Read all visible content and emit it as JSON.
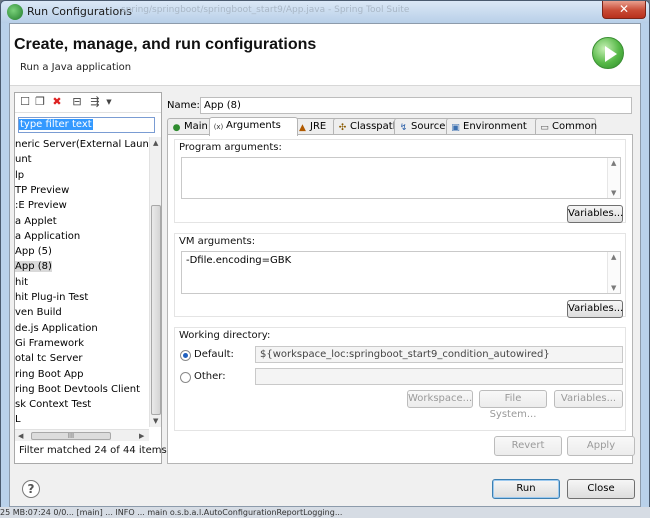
{
  "window": {
    "title": "Run Configurations",
    "faded_title": "spring/springboot/springboot_start9/App.java - Spring Tool Suite",
    "close_glyph": "✕"
  },
  "header": {
    "title": "Create, manage, and run configurations",
    "subtitle": "Run a Java application"
  },
  "left_panel": {
    "toolbar_icons": [
      "new-config-icon",
      "duplicate-icon",
      "delete-icon",
      "collapse-all-icon",
      "filter-icon",
      "dropdown-icon"
    ],
    "filter_placeholder": "type filter text",
    "items": [
      "neric Server(External Launch",
      "unt",
      "lp",
      "TP Preview",
      ":E Preview",
      "a Applet",
      "a Application",
      "App (5)",
      "App (8)",
      "hit",
      "hit Plug-in Test",
      "ven Build",
      "de.js Application",
      "Gi Framework",
      "otal tc Server",
      "ring Boot App",
      "ring Boot Devtools Client",
      "sk Context Test",
      "L"
    ],
    "selected_index": 8,
    "scroll_thumb_label": "III",
    "status": "Filter matched 24 of 44 items"
  },
  "config": {
    "name_label": "Name:",
    "name_value": "App (8)",
    "tabs": [
      {
        "label": "Main",
        "icon": "main-icon"
      },
      {
        "label": "Arguments",
        "icon": "arguments-icon"
      },
      {
        "label": "JRE",
        "icon": "jre-icon"
      },
      {
        "label": "Classpath",
        "icon": "classpath-icon"
      },
      {
        "label": "Source",
        "icon": "source-icon"
      },
      {
        "label": "Environment",
        "icon": "environment-icon"
      },
      {
        "label": "Common",
        "icon": "common-icon"
      }
    ],
    "active_tab": "Arguments",
    "program_args_label": "Program arguments:",
    "program_args_value": "",
    "vm_args_label": "VM arguments:",
    "vm_args_value": "-Dfile.encoding=GBK",
    "variables_button": "Variables...",
    "working_dir_label": "Working directory:",
    "default_label": "Default:",
    "default_value": "${workspace_loc:springboot_start9_condition_autowired}",
    "other_label": "Other:",
    "other_value": "",
    "workspace_button": "Workspace...",
    "filesystem_button": "File System...",
    "variables_button_2": "Variables...",
    "revert_button": "Revert",
    "apply_button": "Apply"
  },
  "footer": {
    "help_glyph": "?",
    "run_button": "Run",
    "close_button": "Close"
  },
  "bottom_strip_text": "25 MB:07:24 0/0...  [main] ... INFO ...   main o.s.b.a.l.AutoConfigurationReportLogging..."
}
